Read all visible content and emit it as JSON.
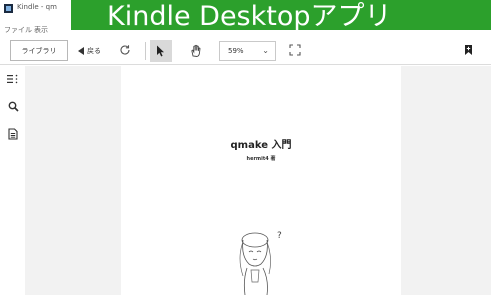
{
  "window": {
    "title": "Kindle - qm"
  },
  "menubar": {
    "items": [
      "ファイル",
      "表示"
    ]
  },
  "banner": {
    "text": "Kindle Desktopアプリ"
  },
  "toolbar": {
    "library_label": "ライブラリ",
    "back_label": "戻る",
    "zoom_value": "59%"
  },
  "sidebar": {
    "icons": [
      "toc-icon",
      "search-icon",
      "notes-icon"
    ]
  },
  "page": {
    "title": "qmake 入門",
    "author": "hermit4 著"
  },
  "colors": {
    "banner": "#2ca02c",
    "reader_bg": "#f2f2f2",
    "active_tool": "#d9d9d9"
  }
}
